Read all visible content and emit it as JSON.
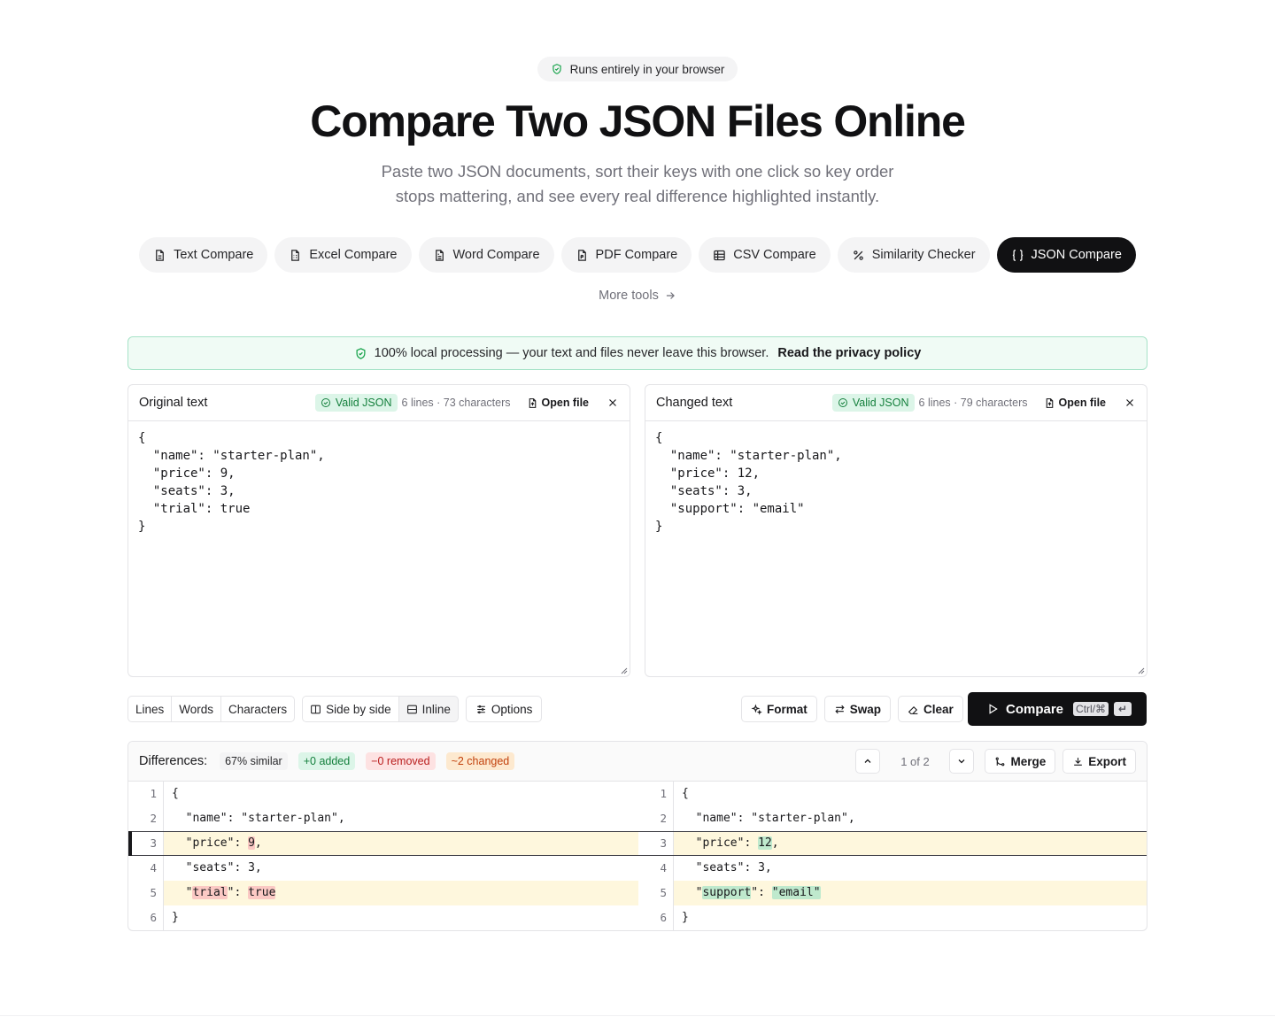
{
  "hero": {
    "badge": "Runs entirely in your browser",
    "title": "Compare Two JSON Files Online",
    "subtitle_line1": "Paste two JSON documents, sort their keys with one click so key order",
    "subtitle_line2": "stops mattering, and see every real difference highlighted instantly."
  },
  "tools": [
    {
      "label": "Text Compare",
      "icon": "file-text-icon"
    },
    {
      "label": "Excel Compare",
      "icon": "spreadsheet-icon"
    },
    {
      "label": "Word Compare",
      "icon": "document-icon"
    },
    {
      "label": "PDF Compare",
      "icon": "pdf-icon"
    },
    {
      "label": "CSV Compare",
      "icon": "table-icon"
    },
    {
      "label": "Similarity Checker",
      "icon": "percent-icon"
    },
    {
      "label": "JSON Compare",
      "icon": "braces-icon",
      "active": true
    }
  ],
  "more_tools": "More tools",
  "privacy": {
    "text": "100% local processing — your text and files never leave this browser.",
    "link": "Read the privacy policy"
  },
  "original": {
    "title": "Original text",
    "valid": "Valid JSON",
    "stats": "6 lines · 73 characters",
    "open_file": "Open file",
    "content": "{\n  \"name\": \"starter-plan\",\n  \"price\": 9,\n  \"seats\": 3,\n  \"trial\": true\n}"
  },
  "changed": {
    "title": "Changed text",
    "valid": "Valid JSON",
    "stats": "6 lines · 79 characters",
    "open_file": "Open file",
    "content": "{\n  \"name\": \"starter-plan\",\n  \"price\": 12,\n  \"seats\": 3,\n  \"support\": \"email\"\n}"
  },
  "toolbar": {
    "granularity": [
      "Lines",
      "Words",
      "Characters"
    ],
    "view": [
      "Side by side",
      "Inline"
    ],
    "options": "Options",
    "format": "Format",
    "swap": "Swap",
    "clear": "Clear",
    "compare": "Compare",
    "shortcut": "Ctrl/⌘",
    "enter": "↵"
  },
  "differences": {
    "title": "Differences:",
    "similar": "67% similar",
    "added": "+0 added",
    "removed": "−0 removed",
    "changed": "~2 changed",
    "position": "1 of 2",
    "merge": "Merge",
    "export": "Export"
  },
  "diff_rows": {
    "left": [
      {
        "n": "1",
        "text": "{"
      },
      {
        "n": "2",
        "text": "  \"name\": \"starter-plan\","
      },
      {
        "n": "3",
        "pre": "  \"price\": ",
        "hl": "9",
        "post": ","
      },
      {
        "n": "4",
        "text": "  \"seats\": 3,"
      },
      {
        "n": "5",
        "pre": "  \"",
        "hl": "trial",
        "mid": "\": ",
        "hl2": "true",
        "post": ""
      },
      {
        "n": "6",
        "text": "}"
      }
    ],
    "right": [
      {
        "n": "1",
        "text": "{"
      },
      {
        "n": "2",
        "text": "  \"name\": \"starter-plan\","
      },
      {
        "n": "3",
        "pre": "  \"price\": ",
        "hl": "12",
        "post": ","
      },
      {
        "n": "4",
        "text": "  \"seats\": 3,"
      },
      {
        "n": "5",
        "pre": "  \"",
        "hl": "support",
        "mid": "\": ",
        "hl2": "\"email\"",
        "post": ""
      },
      {
        "n": "6",
        "text": "}"
      }
    ]
  },
  "colors": {
    "accent": "#111113",
    "changed_row": "#fef7dd",
    "deleted_word": "#fbc9c4",
    "inserted_word": "#bfe9cd",
    "valid_green": "#15803d"
  }
}
